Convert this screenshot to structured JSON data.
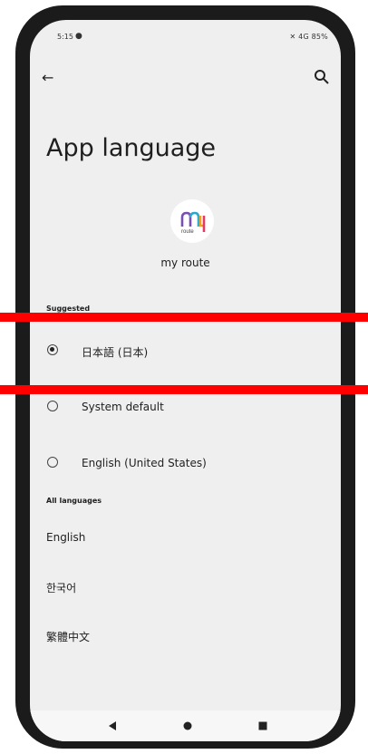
{
  "status_bar": {
    "time": "5:15",
    "right_text": "4G 85%"
  },
  "header": {
    "title": "App language"
  },
  "app": {
    "name": "my route",
    "logo_text": "route"
  },
  "sections": {
    "suggested": "Suggested",
    "all": "All languages"
  },
  "suggested_options": [
    {
      "label": "日本語 (日本)",
      "selected": true
    },
    {
      "label": "System default",
      "selected": false
    },
    {
      "label": "English (United States)",
      "selected": false
    }
  ],
  "all_languages": [
    "English",
    "한국어",
    "繁體中文"
  ],
  "colors": {
    "highlight": "#ff0000",
    "screen_bg": "#efefef",
    "frame": "#1b1b1b"
  }
}
